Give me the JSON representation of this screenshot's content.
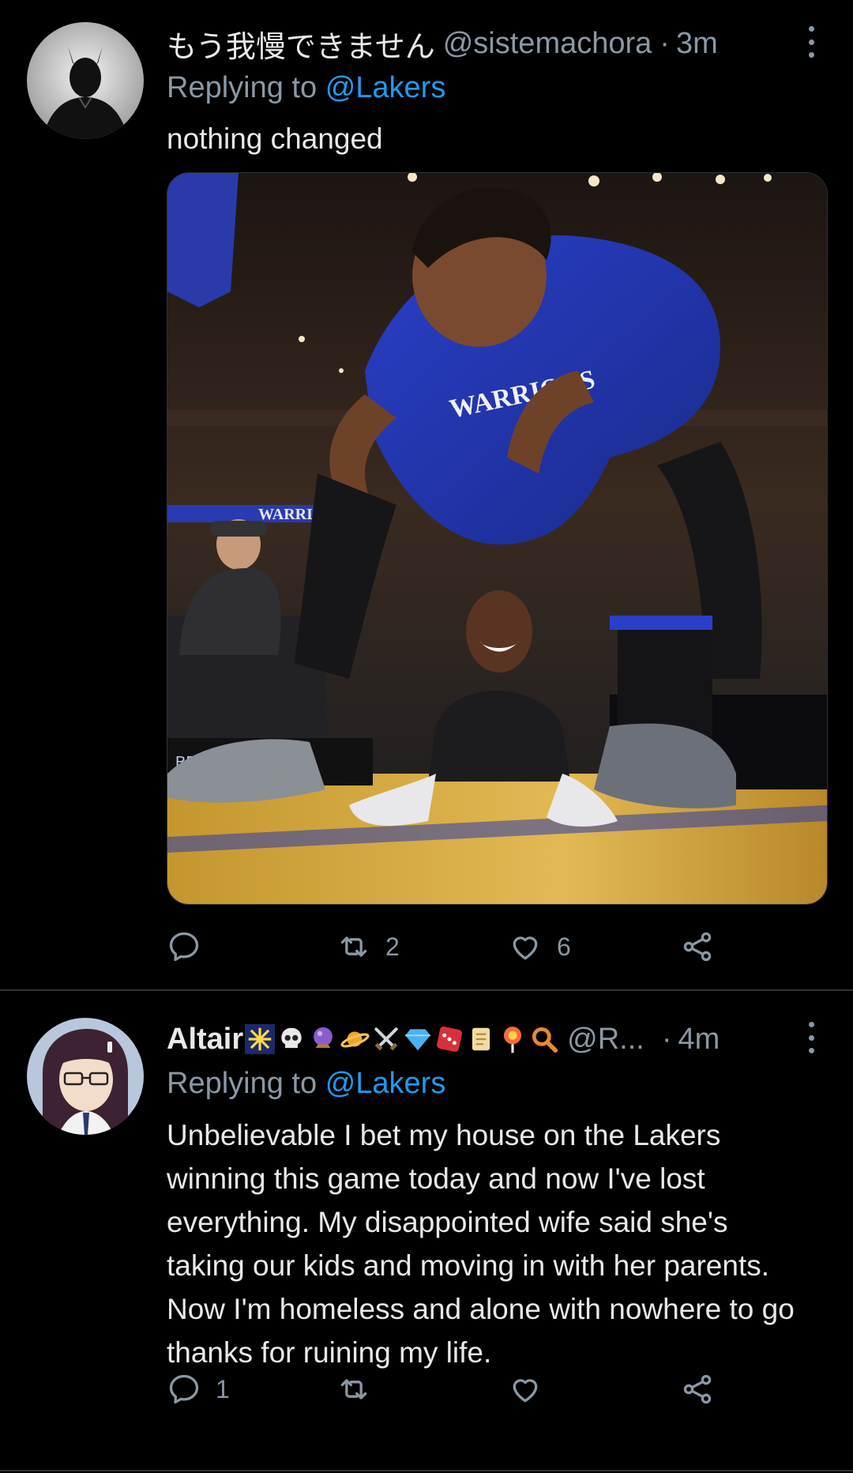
{
  "tweets": [
    {
      "display_name": "もう我慢できません",
      "handle": "@sistemachora",
      "separator": "·",
      "time": "3m",
      "replying_prefix": "Replying to",
      "replying_to": "@Lakers",
      "text": "nothing changed",
      "stats": {
        "replies": "",
        "retweets": "2",
        "likes": "6"
      }
    },
    {
      "display_name": "Altair",
      "name_emojis": [
        "sparkler-icon",
        "skull-icon",
        "crystal-ball-icon",
        "ringed-planet-icon",
        "crossed-swords-icon",
        "gem-icon",
        "dice-icon",
        "scroll-icon",
        "lollipop-icon",
        "magnifier-icon"
      ],
      "handle": "@R...",
      "separator": "·",
      "time": "4m",
      "replying_prefix": "Replying to",
      "replying_to": "@Lakers",
      "text": "Unbelievable I bet my house on the Lakers winning this game today and now I've lost everything. My disappointed wife said she's taking our kids and moving in with her parents. Now I'm homeless and alone with nowhere to go thanks for ruining my life.",
      "stats": {
        "replies": "1",
        "retweets": "",
        "likes": ""
      }
    }
  ],
  "colors": {
    "background": "#000000",
    "text": "#e7e9ea",
    "muted": "#8b98a5",
    "link": "#1d9bf0",
    "divider": "#2f3336"
  }
}
